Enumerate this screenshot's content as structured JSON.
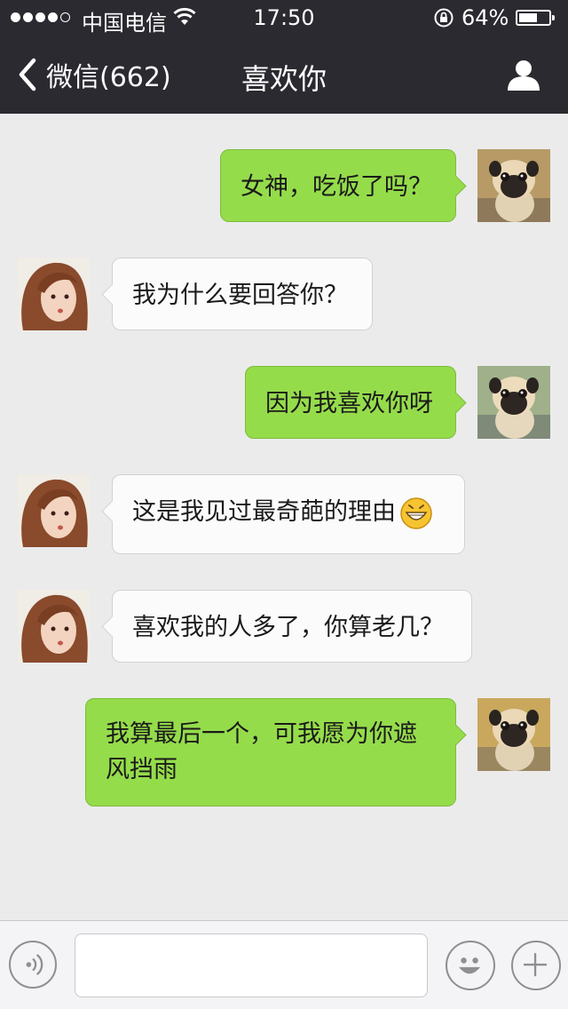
{
  "status_bar": {
    "carrier": "中国电信",
    "time": "17:50",
    "battery_percent": "64%",
    "battery_level": 0.64,
    "signal_bars_filled": 4,
    "signal_bars_total": 5
  },
  "nav": {
    "back_label": "微信(662)",
    "title": "喜欢你",
    "profile_icon": "person-icon",
    "back_icon": "chevron-left-icon"
  },
  "messages": [
    {
      "side": "sent",
      "text": "女神，吃饭了吗？",
      "avatar": "pug-avatar"
    },
    {
      "side": "received",
      "text": "我为什么要回答你？",
      "avatar": "girl-avatar"
    },
    {
      "side": "sent",
      "text": "因为我喜欢你呀",
      "avatar": "pug-avatar"
    },
    {
      "side": "received",
      "text": "这是我见过最奇葩的理由",
      "emoji": "grinning-emoji",
      "avatar": "girl-avatar"
    },
    {
      "side": "received",
      "text": "喜欢我的人多了，你算老几？",
      "avatar": "girl-avatar"
    },
    {
      "side": "sent",
      "text": "我算最后一个，可我愿为你遮风挡雨",
      "avatar": "pug-avatar"
    }
  ],
  "input_bar": {
    "text_value": "",
    "voice_icon": "voice-icon",
    "emoji_icon": "smiley-icon",
    "plus_icon": "plus-icon"
  },
  "colors": {
    "nav_background": "#2b2a30",
    "chat_background": "#ebebeb",
    "sent_bubble": "#95dc4b",
    "received_bubble": "#fbfbfb"
  }
}
